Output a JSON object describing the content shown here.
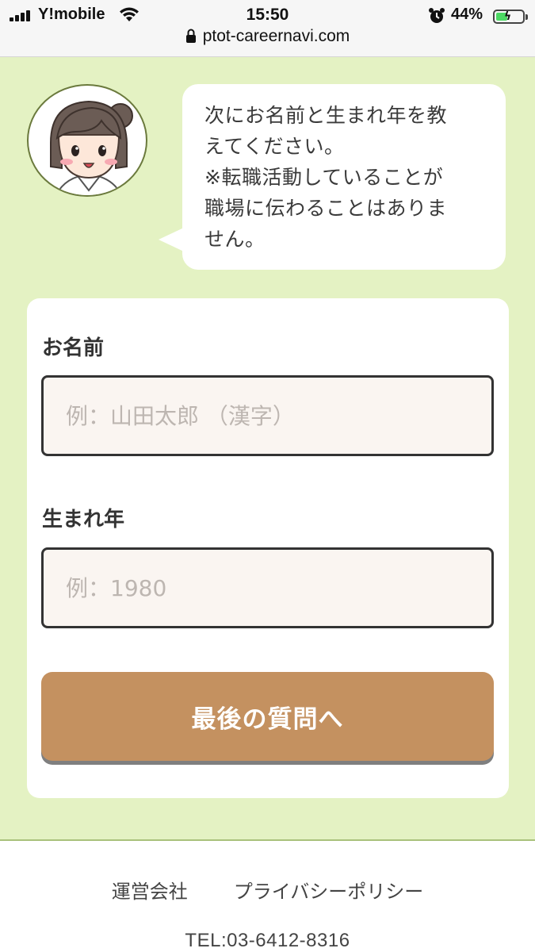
{
  "status_bar": {
    "carrier": "Y!mobile",
    "time": "15:50",
    "battery_percent": "44%",
    "battery_level": 0.44,
    "url": "ptot-careernavi.com",
    "icons": [
      "signal-icon",
      "wifi-icon",
      "alarm-icon",
      "lock-icon",
      "battery-charging-icon"
    ]
  },
  "assistant": {
    "avatar": "nurse-character-avatar",
    "message": "次にお名前と生まれ年を教\nえてください。\n※転職活動していることが\n職場に伝わることはありま\nせん。"
  },
  "form": {
    "name_label": "お名前",
    "name_placeholder": "例：山田太郎 （漢字）",
    "name_value": "",
    "birth_label": "生まれ年",
    "birth_placeholder": "例：1980",
    "birth_value": "",
    "submit_label": "最後の質問へ"
  },
  "footer": {
    "company_link": "運営会社",
    "privacy_link": "プライバシーポリシー",
    "tel": "TEL:03-6412-8316"
  },
  "colors": {
    "background": "#e4f2c3",
    "card": "#ffffff",
    "button": "#c49160",
    "input_bg": "#faf5f1"
  }
}
